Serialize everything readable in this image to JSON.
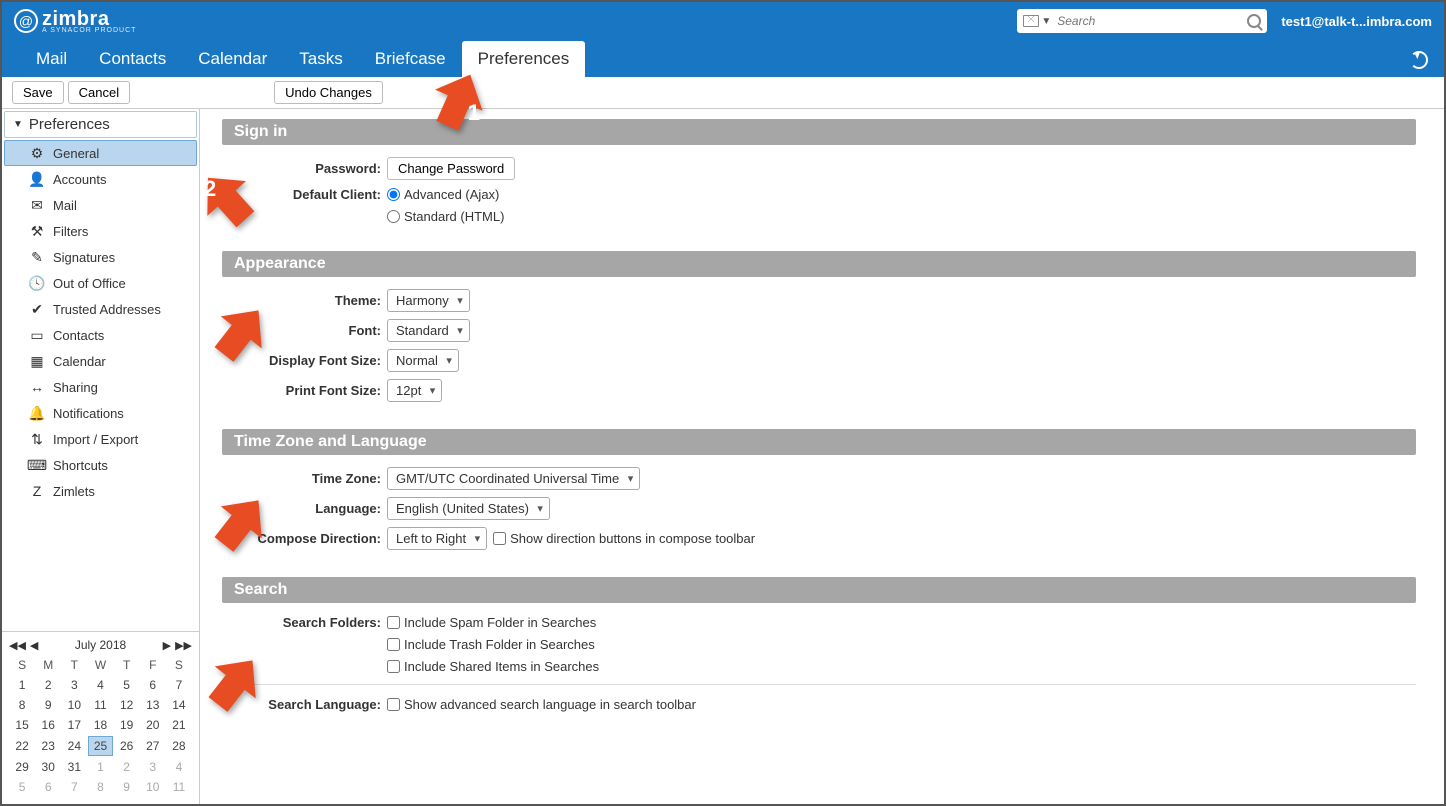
{
  "brand": {
    "name": "zimbra",
    "tagline": "A SYNACOR PRODUCT"
  },
  "header": {
    "search_placeholder": "Search",
    "user": "test1@talk-t...imbra.com"
  },
  "nav": {
    "tabs": [
      "Mail",
      "Contacts",
      "Calendar",
      "Tasks",
      "Briefcase",
      "Preferences"
    ],
    "active": "Preferences"
  },
  "toolbar": {
    "save": "Save",
    "cancel": "Cancel",
    "undo": "Undo Changes"
  },
  "sidebar": {
    "header": "Preferences",
    "items": [
      {
        "label": "General",
        "icon": "⚙"
      },
      {
        "label": "Accounts",
        "icon": "👤"
      },
      {
        "label": "Mail",
        "icon": "✉"
      },
      {
        "label": "Filters",
        "icon": "⚒"
      },
      {
        "label": "Signatures",
        "icon": "✎"
      },
      {
        "label": "Out of Office",
        "icon": "🕓"
      },
      {
        "label": "Trusted Addresses",
        "icon": "✔"
      },
      {
        "label": "Contacts",
        "icon": "▭"
      },
      {
        "label": "Calendar",
        "icon": "▦"
      },
      {
        "label": "Sharing",
        "icon": "↔"
      },
      {
        "label": "Notifications",
        "icon": "🔔"
      },
      {
        "label": "Import / Export",
        "icon": "⇅"
      },
      {
        "label": "Shortcuts",
        "icon": "⌨"
      },
      {
        "label": "Zimlets",
        "icon": "Z"
      }
    ],
    "selected": "General"
  },
  "calendar": {
    "title": "July 2018",
    "dow": [
      "S",
      "M",
      "T",
      "W",
      "T",
      "F",
      "S"
    ],
    "weeks": [
      [
        {
          "d": 1
        },
        {
          "d": 2
        },
        {
          "d": 3
        },
        {
          "d": 4
        },
        {
          "d": 5
        },
        {
          "d": 6
        },
        {
          "d": 7
        }
      ],
      [
        {
          "d": 8
        },
        {
          "d": 9
        },
        {
          "d": 10
        },
        {
          "d": 11
        },
        {
          "d": 12
        },
        {
          "d": 13
        },
        {
          "d": 14
        }
      ],
      [
        {
          "d": 15
        },
        {
          "d": 16
        },
        {
          "d": 17
        },
        {
          "d": 18
        },
        {
          "d": 19
        },
        {
          "d": 20
        },
        {
          "d": 21
        }
      ],
      [
        {
          "d": 22
        },
        {
          "d": 23
        },
        {
          "d": 24
        },
        {
          "d": 25,
          "today": true
        },
        {
          "d": 26
        },
        {
          "d": 27
        },
        {
          "d": 28
        }
      ],
      [
        {
          "d": 29
        },
        {
          "d": 30
        },
        {
          "d": 31
        },
        {
          "d": 1,
          "dim": true
        },
        {
          "d": 2,
          "dim": true
        },
        {
          "d": 3,
          "dim": true
        },
        {
          "d": 4,
          "dim": true
        }
      ],
      [
        {
          "d": 5,
          "dim": true
        },
        {
          "d": 6,
          "dim": true
        },
        {
          "d": 7,
          "dim": true
        },
        {
          "d": 8,
          "dim": true
        },
        {
          "d": 9,
          "dim": true
        },
        {
          "d": 10,
          "dim": true
        },
        {
          "d": 11,
          "dim": true
        }
      ]
    ]
  },
  "sections": {
    "signin": {
      "title": "Sign in",
      "password_label": "Password:",
      "change_password": "Change Password",
      "default_client_label": "Default Client:",
      "client_adv": "Advanced (Ajax)",
      "client_std": "Standard (HTML)"
    },
    "appearance": {
      "title": "Appearance",
      "theme_label": "Theme:",
      "theme_value": "Harmony",
      "font_label": "Font:",
      "font_value": "Standard",
      "display_font_label": "Display Font Size:",
      "display_font_value": "Normal",
      "print_font_label": "Print Font Size:",
      "print_font_value": "12pt"
    },
    "tz": {
      "title": "Time Zone and Language",
      "tz_label": "Time Zone:",
      "tz_value": "GMT/UTC Coordinated Universal Time",
      "lang_label": "Language:",
      "lang_value": "English (United States)",
      "compose_dir_label": "Compose Direction:",
      "compose_dir_value": "Left to Right",
      "show_dir_buttons": "Show direction buttons in compose toolbar"
    },
    "search": {
      "title": "Search",
      "folders_label": "Search Folders:",
      "spam": "Include Spam Folder in Searches",
      "trash": "Include Trash Folder in Searches",
      "shared": "Include Shared Items in Searches",
      "lang_label": "Search Language:",
      "adv_lang": "Show advanced search language in search toolbar"
    }
  },
  "annotations": {
    "a1": "1",
    "a2": "2"
  }
}
